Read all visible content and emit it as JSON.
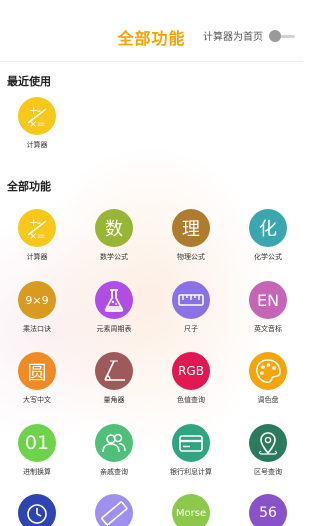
{
  "header": {
    "title": "全部功能",
    "home_setting_label": "计算器为首页",
    "home_toggle_on": false
  },
  "recent": {
    "title": "最近使用",
    "items": [
      {
        "label": "计算器",
        "icon": "calculator-icon",
        "color": "#f7c71a"
      }
    ]
  },
  "all": {
    "title": "全部功能",
    "items": [
      {
        "label": "计算器",
        "icon": "calculator-icon",
        "color": "#f7c71a"
      },
      {
        "label": "数学公式",
        "icon_text": "数",
        "color": "#97b635"
      },
      {
        "label": "物理公式",
        "icon_text": "理",
        "color": "#b07a2f"
      },
      {
        "label": "化学公式",
        "icon_text": "化",
        "color": "#3aa7b0"
      },
      {
        "label": "乘法口诀",
        "icon_text": "9×9",
        "color": "#d99a22"
      },
      {
        "label": "元素周期表",
        "icon": "flask-icon",
        "color": "#b04de4"
      },
      {
        "label": "尺子",
        "icon": "ruler-icon",
        "color": "#8a72e6"
      },
      {
        "label": "英文音标",
        "icon_text": "EN",
        "color": "#c664b5"
      },
      {
        "label": "大写中文",
        "icon_text": "圆",
        "color": "#f08a24"
      },
      {
        "label": "量角器",
        "icon": "protractor-icon",
        "color": "#9c5a5a"
      },
      {
        "label": "色值查询",
        "icon_text": "RGB",
        "color": "#e01952"
      },
      {
        "label": "调色盘",
        "icon": "palette-icon",
        "color": "#f5a40c"
      },
      {
        "label": "进制换算",
        "icon_text": "01",
        "color": "#6cd34a"
      },
      {
        "label": "亲戚查询",
        "icon": "people-icon",
        "color": "#4fbf7a"
      },
      {
        "label": "银行利息计算",
        "icon": "bank-card-icon",
        "color": "#2fa584"
      },
      {
        "label": "区号查询",
        "icon": "map-pin-icon",
        "color": "#2a7a5e"
      },
      {
        "label": "",
        "icon": "timer-icon",
        "color": "#2f44b3"
      },
      {
        "label": "",
        "icon": "ruler-diagonal-icon",
        "color": "#9f8ff0"
      },
      {
        "label": "",
        "icon_text": "Morse",
        "color": "#8cc94a"
      },
      {
        "label": "",
        "icon_text": "56",
        "color": "#8a52c9"
      }
    ]
  }
}
